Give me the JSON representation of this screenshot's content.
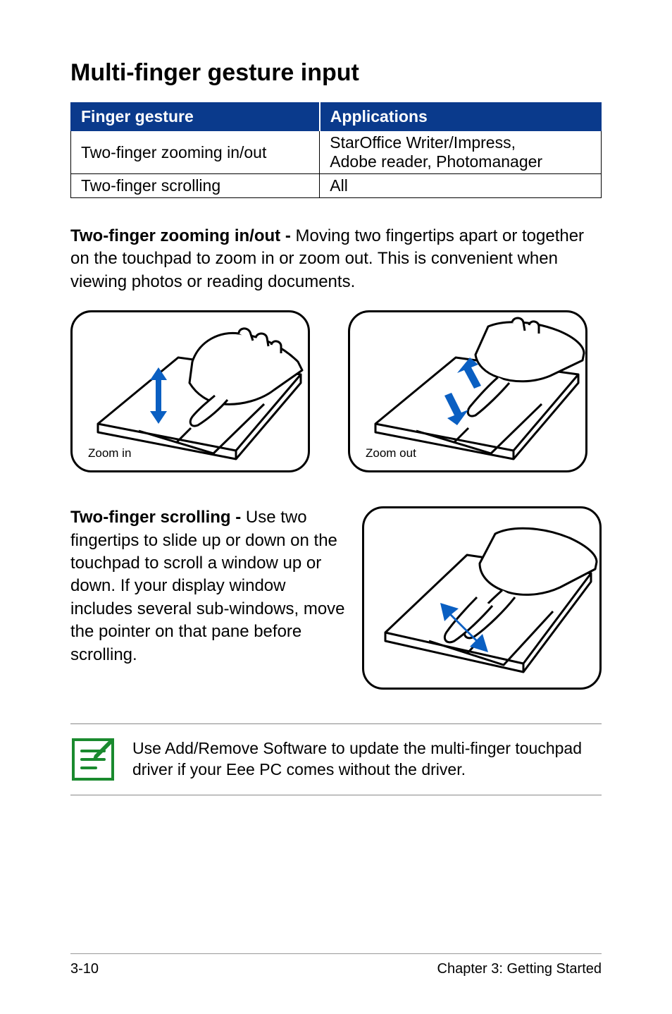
{
  "heading": "Multi-finger gesture input",
  "table": {
    "headers": [
      "Finger gesture",
      "Applications"
    ],
    "rows": [
      {
        "gesture": "Two-finger zooming in/out",
        "apps": "StarOffice Writer/Impress,\nAdobe reader, Photomanager"
      },
      {
        "gesture": "Two-finger scrolling",
        "apps": "All"
      }
    ]
  },
  "para_zoom": {
    "lead": "Two-finger zooming in/out - ",
    "body": "Moving two fingertips apart or together on the touchpad to zoom in or zoom out. This is convenient when viewing photos or reading documents."
  },
  "captions": {
    "zoom_in": "Zoom in",
    "zoom_out": "Zoom out"
  },
  "para_scroll": {
    "lead": "Two-finger scrolling - ",
    "body": "Use two fingertips to slide up or down on the touchpad to scroll a window up or down. If your display window includes several sub-windows, move the pointer on that pane before scrolling."
  },
  "note": "Use Add/Remove Software to update the multi-finger touchpad driver if your Eee PC comes without the driver.",
  "footer": {
    "page": "3-10",
    "chapter": "Chapter 3: Getting Started"
  }
}
